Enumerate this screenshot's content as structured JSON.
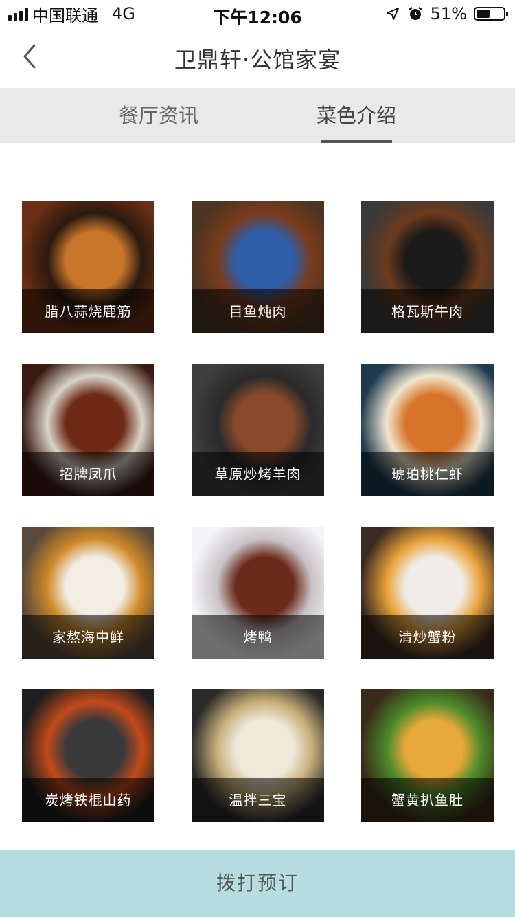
{
  "status_bar": {
    "carrier": "中国联通",
    "network": "4G",
    "time": "下午12:06",
    "battery_text": "51%",
    "battery_level": 0.51
  },
  "nav": {
    "title": "卫鼎轩·公馆家宴",
    "back_icon": "chevron-left-icon"
  },
  "tabs": [
    {
      "label": "餐厅资讯",
      "active": false
    },
    {
      "label": "菜色介绍",
      "active": true
    }
  ],
  "dishes": [
    {
      "name": "腊八蒜烧鹿筋",
      "colors": [
        "#6b2e14",
        "#c7762a",
        "#2a1a10"
      ]
    },
    {
      "name": "目鱼炖肉",
      "colors": [
        "#4a3424",
        "#2f5da8",
        "#7a3b1a"
      ]
    },
    {
      "name": "格瓦斯牛肉",
      "colors": [
        "#3a3a3a",
        "#1a1a1a",
        "#6b3a1c"
      ]
    },
    {
      "name": "招牌凤爪",
      "colors": [
        "#3a1a12",
        "#6e2a14",
        "#d9d3c8"
      ]
    },
    {
      "name": "草原炒烤羊肉",
      "colors": [
        "#3e3e3e",
        "#8a4a2a",
        "#2a2a2a"
      ]
    },
    {
      "name": "琥珀桃仁虾",
      "colors": [
        "#1f3b4f",
        "#d8742a",
        "#f0e6d0"
      ]
    },
    {
      "name": "家熬海中鲜",
      "colors": [
        "#5a4a3a",
        "#f2eee6",
        "#d08a2a"
      ]
    },
    {
      "name": "烤鸭",
      "colors": [
        "#f4f4f6",
        "#6b2a1a",
        "#c9c2c6"
      ]
    },
    {
      "name": "清炒蟹粉",
      "colors": [
        "#3a2a22",
        "#f0ede8",
        "#e8a23a"
      ]
    },
    {
      "name": "炭烤铁棍山药",
      "colors": [
        "#1e1e1e",
        "#3a3a3a",
        "#c24a1a"
      ]
    },
    {
      "name": "温拌三宝",
      "colors": [
        "#2a2a2a",
        "#efe9dc",
        "#c8b07a"
      ]
    },
    {
      "name": "蟹黄扒鱼肚",
      "colors": [
        "#3a2a1a",
        "#e8a83a",
        "#4a8a2a"
      ]
    }
  ],
  "cta": {
    "label": "拨打预订"
  }
}
